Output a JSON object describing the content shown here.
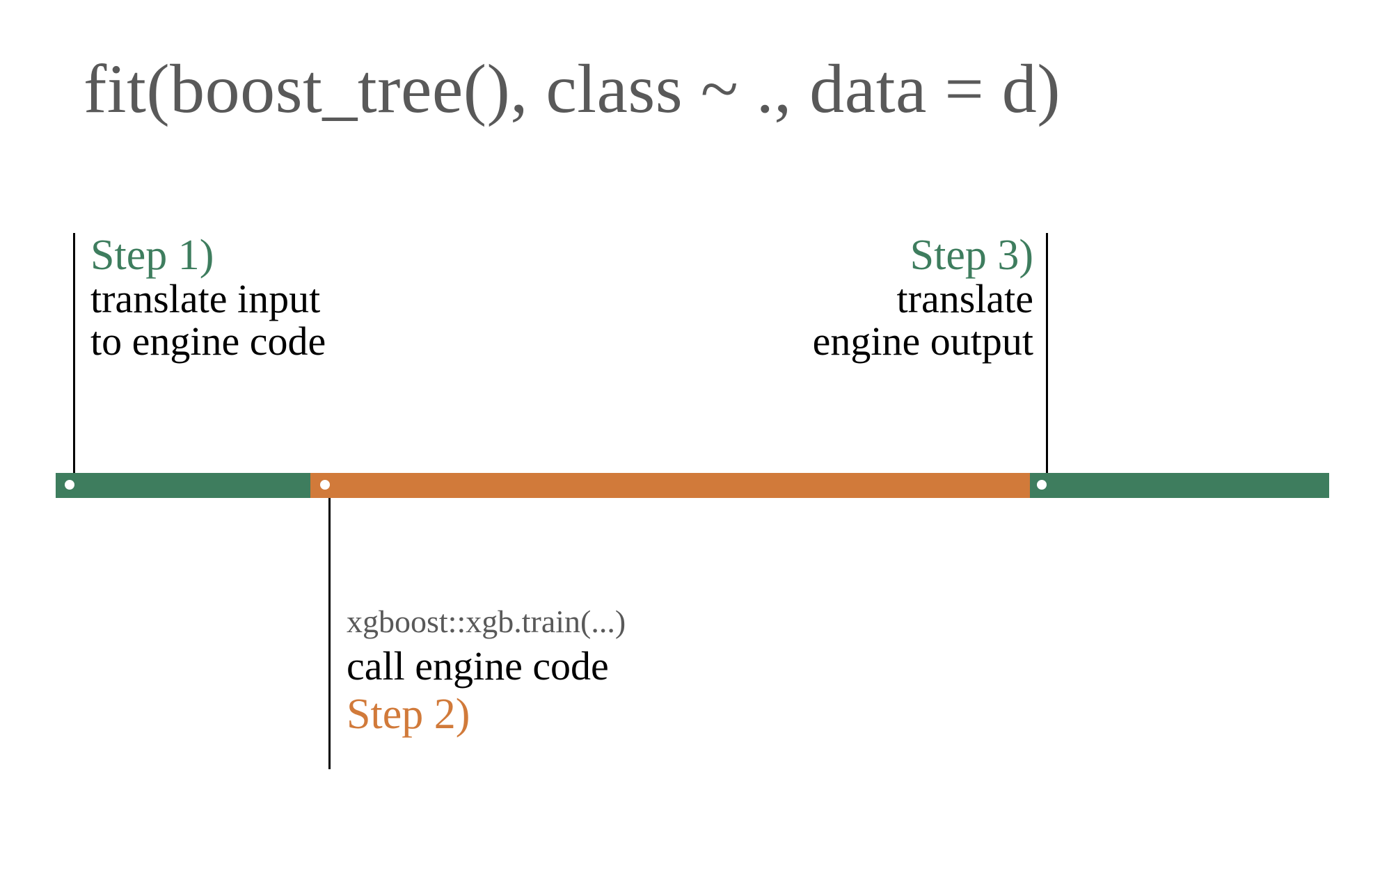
{
  "title": "fit(boost_tree(), class ~ ., data = d)",
  "colors": {
    "green": "#3e7d5e",
    "orange": "#d17a3a",
    "title_grey": "#595959"
  },
  "timeline": {
    "segments": [
      {
        "start_frac": 0.0,
        "end_frac": 0.2,
        "color": "green"
      },
      {
        "start_frac": 0.2,
        "end_frac": 0.765,
        "color": "orange"
      },
      {
        "start_frac": 0.765,
        "end_frac": 1.0,
        "color": "green"
      }
    ],
    "markers_frac": [
      0.0,
      0.2,
      0.765
    ]
  },
  "steps": {
    "step1": {
      "title": "Step 1)",
      "body_line1": "translate input",
      "body_line2": "to engine code"
    },
    "step2": {
      "code": "xgboost::xgb.train(...)",
      "body": "call engine code",
      "title": "Step 2)"
    },
    "step3": {
      "title": "Step 3)",
      "body_line1": "translate",
      "body_line2": "engine output"
    }
  }
}
